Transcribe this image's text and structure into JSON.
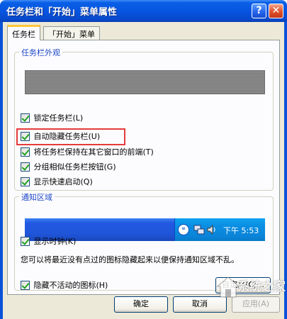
{
  "window": {
    "title": "任务栏和「开始」菜单属性",
    "help_label": "?",
    "close_label": "✕"
  },
  "tabs": [
    {
      "label": "任务栏",
      "active": true
    },
    {
      "label": "「开始」菜单",
      "active": false
    }
  ],
  "appearance_group": {
    "legend": "任务栏外观",
    "options": [
      {
        "label": "锁定任务栏(L)",
        "checked": true
      },
      {
        "label": "自动隐藏任务栏(U)",
        "checked": true,
        "highlighted": true
      },
      {
        "label": "将任务栏保持在其它窗口的前端(T)",
        "checked": true
      },
      {
        "label": "分组相似任务栏按钮(G)",
        "checked": true
      },
      {
        "label": "显示快速启动(Q)",
        "checked": true
      }
    ]
  },
  "notification_group": {
    "legend": "通知区域",
    "tray_preview": {
      "chevron_label": "«",
      "clock_text": "下午 5:53"
    },
    "show_clock": {
      "label": "显示时钟(K)",
      "checked": true
    },
    "description": "您可以将最近没有点过的图标隐藏起来以便保持通知区域不乱。",
    "hide_inactive": {
      "label": "隐藏不活动的图标(H)",
      "checked": true
    },
    "customize_label": "自定义(C)..."
  },
  "buttons": {
    "ok": "确定",
    "cancel": "取消",
    "apply": "应用(A)"
  },
  "watermark": {
    "text": "系统之家"
  },
  "colors": {
    "highlight": "#e53b3b",
    "legend": "#1f47c7",
    "titlebar": "#0654e0"
  },
  "icons": {
    "network": "network-icon",
    "volume": "volume-icon"
  }
}
